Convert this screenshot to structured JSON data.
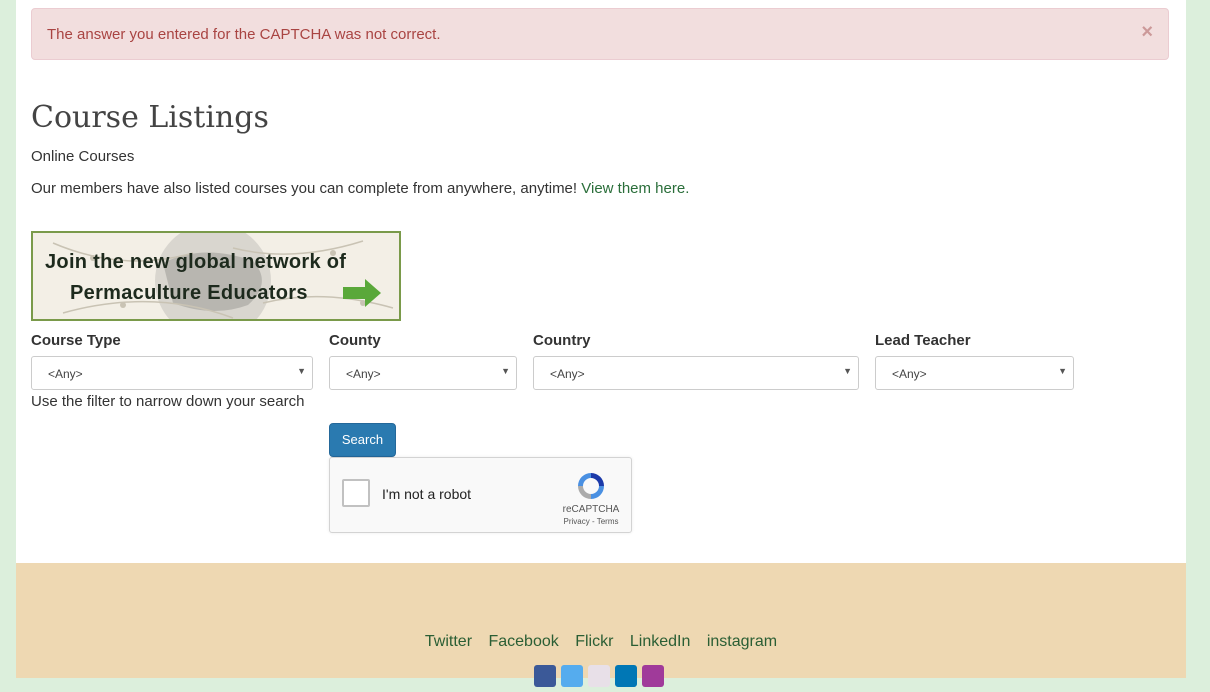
{
  "alert": {
    "message": "The answer you entered for the CAPTCHA was not correct.",
    "close_glyph": "×"
  },
  "page": {
    "title": "Course Listings",
    "subtitle": "Online Courses",
    "description_text": "Our members have also listed courses you can complete from anywhere, anytime! ",
    "description_link": "View them here."
  },
  "banner": {
    "line1": "Join the new global network of",
    "line2": "Permaculture Educators"
  },
  "filters": {
    "course_type": {
      "label": "Course Type",
      "value": "<Any>"
    },
    "county": {
      "label": "County",
      "value": "<Any>"
    },
    "country": {
      "label": "Country",
      "value": "<Any>"
    },
    "lead_teacher": {
      "label": "Lead Teacher",
      "value": "<Any>"
    },
    "help_text": "Use the filter to narrow down your search",
    "caret": "▼"
  },
  "search_button": "Search",
  "captcha": {
    "label": "I'm not a robot",
    "brand": "reCAPTCHA",
    "links": "Privacy - Terms"
  },
  "footer": {
    "links": [
      "Twitter",
      "Facebook",
      "Flickr",
      "LinkedIn",
      "instagram"
    ]
  },
  "colors": {
    "page_bg": "#dcefdc",
    "alert_bg": "#f2dede",
    "alert_text": "#a94442",
    "link": "#2a6e3a",
    "button": "#2a7ab0",
    "footer_bg": "#eed8b2"
  }
}
